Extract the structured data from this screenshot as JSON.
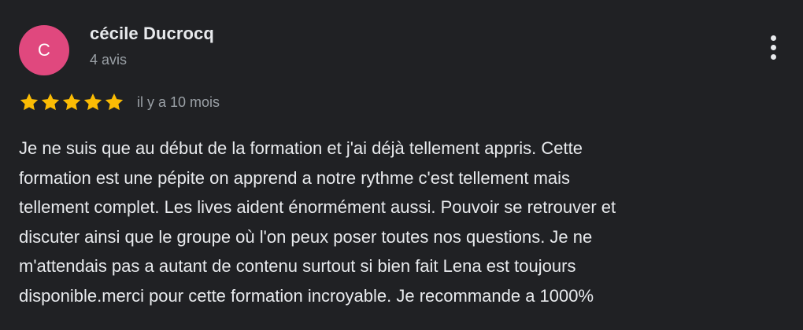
{
  "reviewer": {
    "initial": "C",
    "name": "cécile Ducrocq",
    "meta": "4 avis",
    "avatar_color": "#e0487e"
  },
  "menu": {
    "icon": "more-vert-icon"
  },
  "rating": {
    "stars": 5,
    "max": 5,
    "star_color": "#fbbc04",
    "date": "il y a 10 mois"
  },
  "review": {
    "text": "Je ne suis que au début de la formation et j'ai déjà tellement appris. Cette\nformation est une pépite on apprend a notre rythme c'est tellement mais\ntellement complet. Les lives aident énormément aussi. Pouvoir se retrouver et\ndiscuter ainsi que le groupe où l'on peux poser toutes nos questions. Je ne\nm'attendais pas a autant de contenu surtout si bien fait Lena est toujours\ndisponible.merci pour cette formation incroyable. Je recommande a 1000%"
  }
}
